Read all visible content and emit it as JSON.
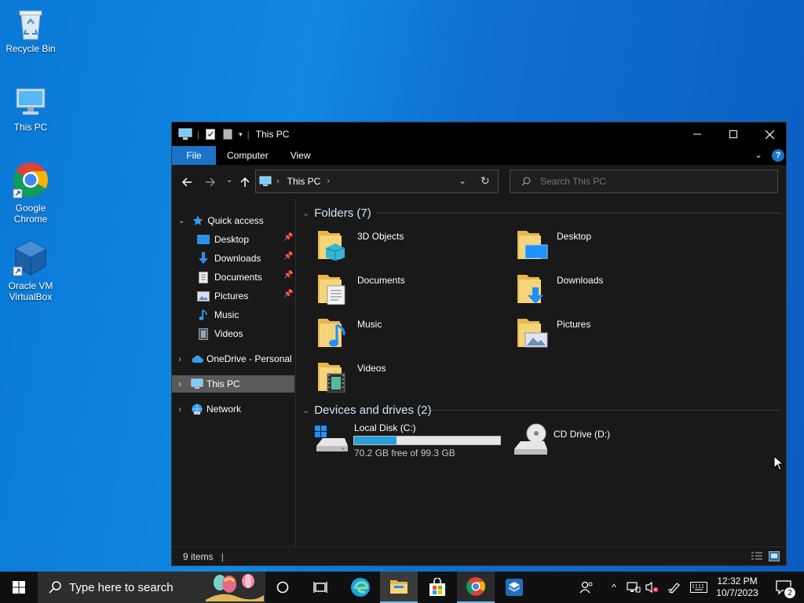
{
  "desktop": {
    "icons": [
      {
        "label": "Recycle Bin"
      },
      {
        "label": "This PC"
      },
      {
        "label": "Google Chrome"
      },
      {
        "label": "Oracle VM VirtualBox"
      }
    ]
  },
  "window": {
    "title": "This PC",
    "ribbon_tabs": [
      "File",
      "Computer",
      "View"
    ],
    "address": {
      "crumb": "This PC"
    },
    "search": {
      "placeholder": "Search This PC"
    },
    "nav": {
      "quick_access": "Quick access",
      "pinned": [
        "Desktop",
        "Downloads",
        "Documents",
        "Pictures"
      ],
      "unpinned": [
        "Music",
        "Videos"
      ],
      "onedrive": "OneDrive - Personal",
      "this_pc": "This PC",
      "network": "Network"
    },
    "groups": {
      "folders": "Folders (7)",
      "devices": "Devices and drives (2)"
    },
    "folders": [
      "3D Objects",
      "Desktop",
      "Documents",
      "Downloads",
      "Music",
      "Pictures",
      "Videos"
    ],
    "drives": [
      {
        "label": "Local Disk (C:)",
        "free_text": "70.2 GB free of 99.3 GB",
        "used_fraction": 0.293
      },
      {
        "label": "CD Drive (D:)"
      }
    ],
    "status": {
      "items": "9 items"
    }
  },
  "taskbar": {
    "search_placeholder": "Type here to search",
    "time": "12:32 PM",
    "date": "10/7/2023",
    "notification_count": "2"
  },
  "colors": {
    "accent": "#1a73c8",
    "drive_bar": "#26a0da"
  }
}
